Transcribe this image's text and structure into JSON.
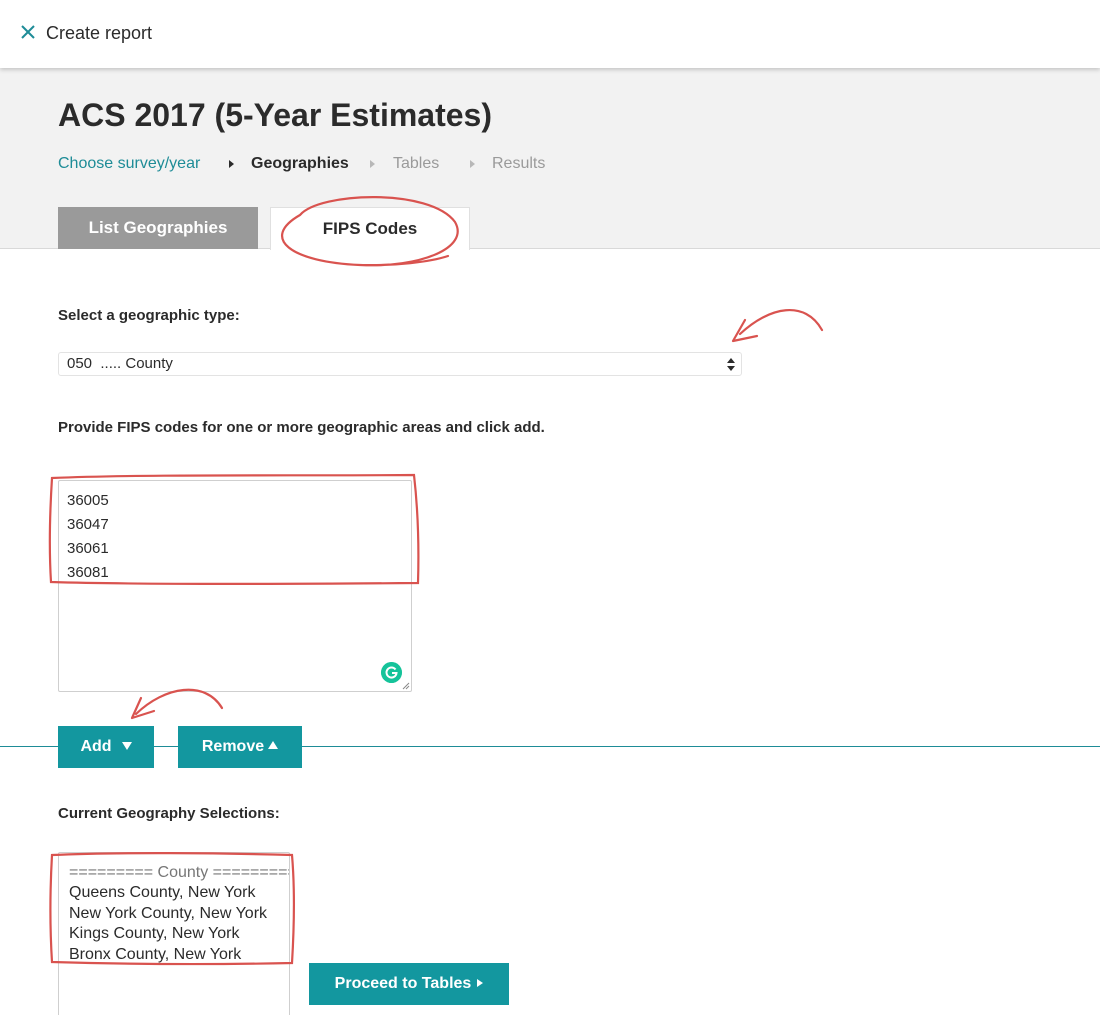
{
  "topbar": {
    "close_icon": "close-icon",
    "title": "Create report"
  },
  "header": {
    "title": "ACS 2017 (5-Year Estimates)",
    "breadcrumb": [
      {
        "label": "Choose survey/year",
        "state": "link"
      },
      {
        "label": "Geographies",
        "state": "active"
      },
      {
        "label": "Tables",
        "state": "inactive"
      },
      {
        "label": "Results",
        "state": "inactive"
      }
    ],
    "tabs": [
      {
        "label": "List Geographies",
        "selected": false
      },
      {
        "label": "FIPS Codes",
        "selected": true
      }
    ]
  },
  "form": {
    "geo_type_label": "Select a geographic type:",
    "geo_type_value": "050  ..... County",
    "fips_label": "Provide FIPS codes for one or more geographic areas and click add.",
    "fips_codes": [
      "36005",
      "36047",
      "36061",
      "36081"
    ],
    "add_label": "Add",
    "remove_label": "Remove",
    "selections_label": "Current Geography Selections:",
    "selections": [
      "========= County =========",
      "Queens County, New York",
      "New York County, New York",
      "Kings County, New York",
      "Bronx County, New York"
    ],
    "proceed_label": "Proceed to Tables"
  },
  "colors": {
    "accent": "#13979f",
    "link": "#1e8c97",
    "annotation": "#d9534f",
    "tab_inactive": "#9a9a9a"
  }
}
